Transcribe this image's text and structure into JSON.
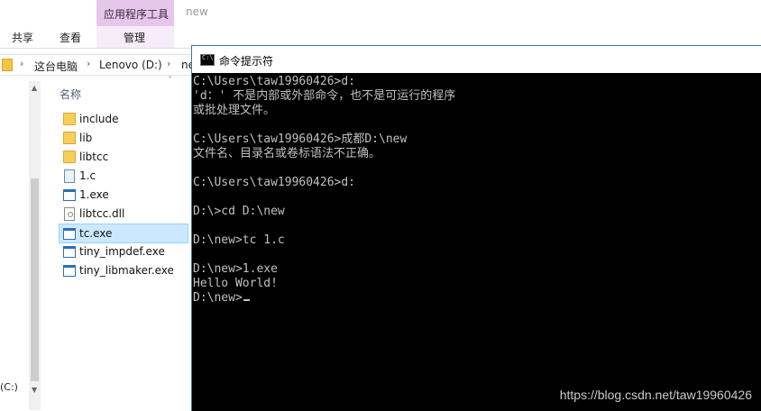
{
  "ribbon": {
    "context_group": "应用程序工具",
    "title": "new",
    "tabs": [
      "共享",
      "查看"
    ],
    "context_tab": "管理"
  },
  "address": {
    "crumbs": [
      "这台电脑",
      "Lenovo (D:)",
      "ne"
    ]
  },
  "nav": {
    "drive": "(C:)"
  },
  "filelist": {
    "column_name": "名称",
    "files": [
      {
        "name": "include",
        "icon": "folder-icon"
      },
      {
        "name": "lib",
        "icon": "folder-icon"
      },
      {
        "name": "libtcc",
        "icon": "folder-icon"
      },
      {
        "name": "1.c",
        "icon": "c-file-icon"
      },
      {
        "name": "1.exe",
        "icon": "exe-icon"
      },
      {
        "name": "libtcc.dll",
        "icon": "dll-icon"
      },
      {
        "name": "tc.exe",
        "icon": "exe-icon",
        "selected": true
      },
      {
        "name": "tiny_impdef.exe",
        "icon": "exe-icon"
      },
      {
        "name": "tiny_libmaker.exe",
        "icon": "exe-icon"
      }
    ]
  },
  "console": {
    "title": "命令提示符",
    "icon_label": "C:\\",
    "lines": [
      "C:\\Users\\taw19960426>d:",
      "'d：' 不是内部或外部命令，也不是可运行的程序",
      "或批处理文件。",
      "",
      "C:\\Users\\taw19960426>成都D:\\new",
      "文件名、目录名或卷标语法不正确。",
      "",
      "C:\\Users\\taw19960426>d:",
      "",
      "D:\\>cd D:\\new",
      "",
      "D:\\new>tc 1.c",
      "",
      "D:\\new>1.exe",
      "Hello World!",
      "D:\\new>"
    ]
  },
  "watermark": "https://blog.csdn.net/taw19960426"
}
